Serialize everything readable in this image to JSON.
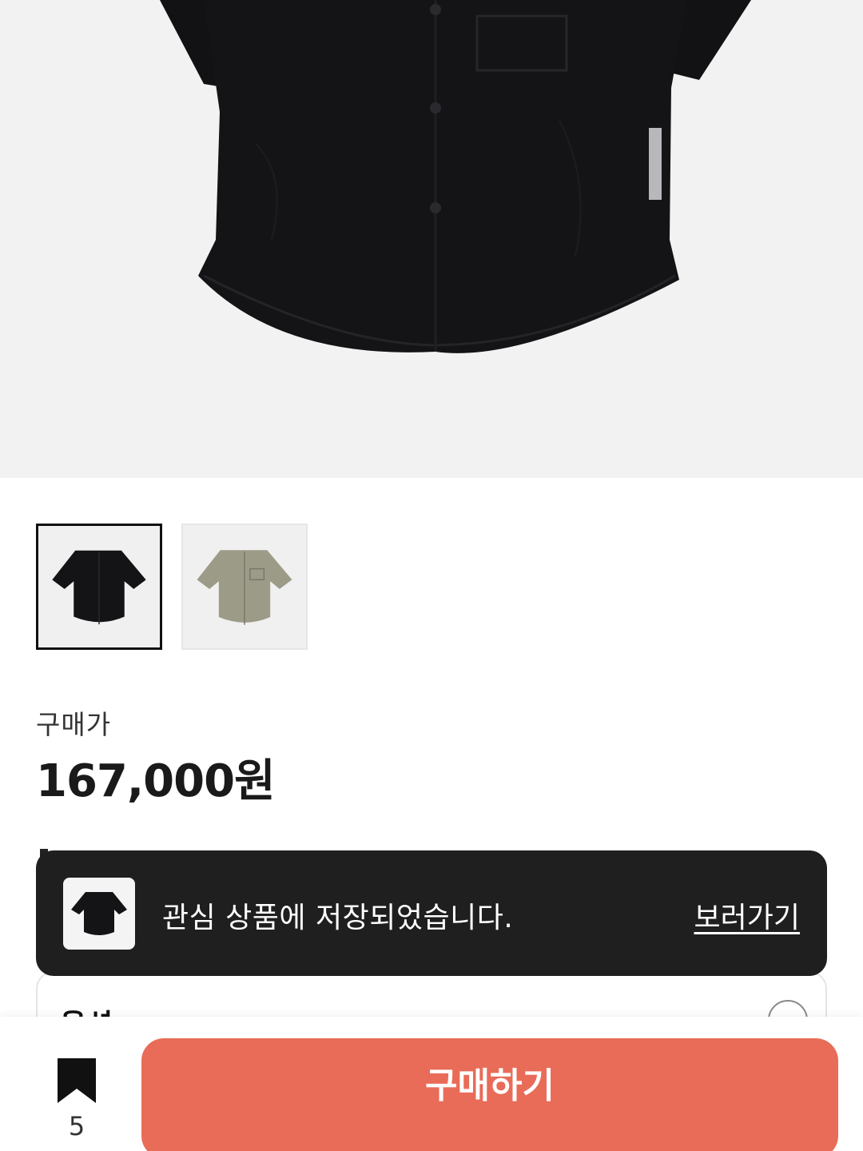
{
  "product": {
    "colors": {
      "hero_bg": "#f2f2f2",
      "shirt_black": "#141416",
      "shirt_beige": "#9c9b88"
    },
    "thumbnails": [
      {
        "name": "black shirt",
        "selected": true
      },
      {
        "name": "beige shirt",
        "selected": false
      }
    ],
    "price_label": "구매가",
    "price": "167,000원"
  },
  "option": {
    "title": "옵션"
  },
  "toast": {
    "message": "관심 상품에 저장되었습니다.",
    "link_label": "보러가기"
  },
  "bottom_bar": {
    "bookmark_icon": "bookmark-icon",
    "bookmark_count": "5",
    "buy_label": "구매하기",
    "buy_color": "#e86c58"
  }
}
